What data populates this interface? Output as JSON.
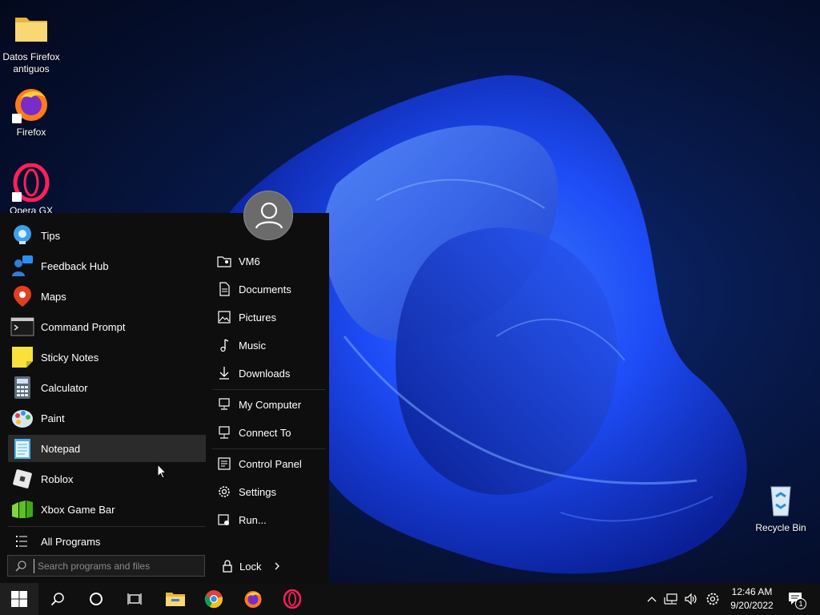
{
  "desktop": {
    "icons": [
      {
        "label": "Datos Firefox antiguos",
        "icon": "folder-icon"
      },
      {
        "label": "Firefox",
        "icon": "firefox-icon"
      },
      {
        "label": "Opera GX",
        "icon": "opera-gx-icon"
      },
      {
        "label": "Recycle Bin",
        "icon": "recycle-bin-icon"
      }
    ]
  },
  "start_menu": {
    "programs": [
      {
        "label": "Tips",
        "icon": "tips-icon"
      },
      {
        "label": "Feedback Hub",
        "icon": "feedback-hub-icon"
      },
      {
        "label": "Maps",
        "icon": "maps-icon"
      },
      {
        "label": "Command Prompt",
        "icon": "command-prompt-icon"
      },
      {
        "label": "Sticky Notes",
        "icon": "sticky-notes-icon"
      },
      {
        "label": "Calculator",
        "icon": "calculator-icon"
      },
      {
        "label": "Paint",
        "icon": "paint-icon"
      },
      {
        "label": "Notepad",
        "icon": "notepad-icon"
      },
      {
        "label": "Roblox",
        "icon": "roblox-icon"
      },
      {
        "label": "Xbox Game Bar",
        "icon": "xbox-game-bar-icon"
      }
    ],
    "all_programs": "All Programs",
    "search": {
      "placeholder": "Search programs and files"
    },
    "places": [
      {
        "label": "VM6",
        "icon": "user-folder-icon"
      },
      {
        "label": "Documents",
        "icon": "document-icon"
      },
      {
        "label": "Pictures",
        "icon": "picture-icon"
      },
      {
        "label": "Music",
        "icon": "music-icon"
      },
      {
        "label": "Downloads",
        "icon": "download-icon"
      },
      {
        "label": "My Computer",
        "icon": "computer-icon"
      },
      {
        "label": "Connect To",
        "icon": "connect-icon"
      },
      {
        "label": "Control Panel",
        "icon": "control-panel-icon"
      },
      {
        "label": "Settings",
        "icon": "gear-icon"
      },
      {
        "label": "Run...",
        "icon": "run-icon"
      }
    ],
    "lock": "Lock"
  },
  "taskbar": {
    "clock": {
      "time": "12:46 AM",
      "date": "9/20/2022"
    },
    "notification_count": "1"
  },
  "colors": {
    "menu_bg": "#0e0e0e",
    "taskbar_bg": "#101010",
    "hover_bg": "#2b2b2b",
    "wallpaper_accent": "#1f4fff"
  }
}
